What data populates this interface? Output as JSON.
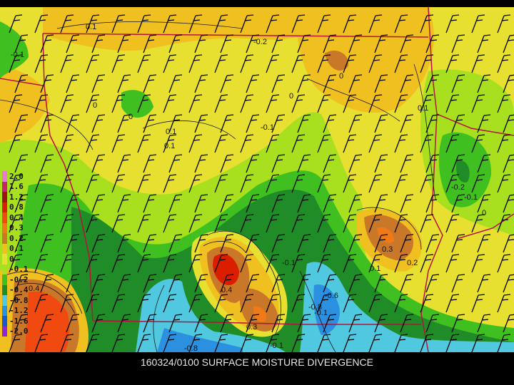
{
  "caption": "160324/0100 SURFACE MOISTURE DIVERGENCE",
  "legend": [
    {
      "label": "2.0",
      "color": "#e87ad2"
    },
    {
      "label": "1.6",
      "color": "#c8246e"
    },
    {
      "label": "1.2",
      "color": "#9a1414"
    },
    {
      "label": "0.8",
      "color": "#dc1e00"
    },
    {
      "label": "0.4",
      "color": "#f04a10"
    },
    {
      "label": "0.3",
      "color": "#f07a18"
    },
    {
      "label": "0.2",
      "color": "#c87828"
    },
    {
      "label": "0.1",
      "color": "#f0c020"
    },
    {
      "label": "0",
      "color": "#e8e030"
    },
    {
      "label": "-0.1",
      "color": "#a8e020"
    },
    {
      "label": "-0.2",
      "color": "#40c020"
    },
    {
      "label": "-0.4",
      "color": "#208c28"
    },
    {
      "label": "-0.8",
      "color": "#50c8e0"
    },
    {
      "label": "-1.2",
      "color": "#2c90e0"
    },
    {
      "label": "-1.6",
      "color": "#1858d0"
    },
    {
      "label": "-2.0",
      "color": "#8c28d8"
    }
  ],
  "contour_labels": [
    "0.1",
    "-0.1",
    "0",
    "-0.2",
    "-0.1",
    "0",
    "0.1",
    "0",
    "0.1",
    "0",
    "0.1",
    "-0.2",
    "-0.1",
    "0",
    "0.3",
    "0.2",
    "0.1",
    "0.4",
    "0.3",
    "-0.1",
    "-0.6",
    "-0.8",
    "-0.1",
    "0.4",
    "-0.8",
    "-0.1"
  ],
  "colors": {
    "background": "#000000",
    "boundary": "#b4143c",
    "wind_barb": "#000000",
    "contour": "#1a1a1a"
  }
}
